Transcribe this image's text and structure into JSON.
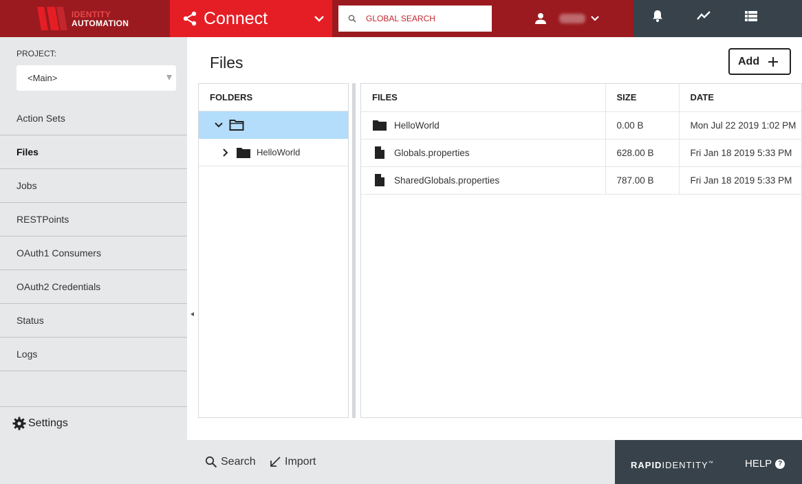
{
  "logo": {
    "line1": "IDENTITY",
    "line2": "AUTOMATION"
  },
  "app_switcher": {
    "name": "Connect"
  },
  "search": {
    "placeholder": "GLOBAL SEARCH"
  },
  "sidebar": {
    "project_label": "PROJECT:",
    "project_value": "<Main>",
    "items": [
      {
        "label": "Action Sets",
        "active": false
      },
      {
        "label": "Files",
        "active": true
      },
      {
        "label": "Jobs",
        "active": false
      },
      {
        "label": "RESTPoints",
        "active": false
      },
      {
        "label": "OAuth1 Consumers",
        "active": false
      },
      {
        "label": "OAuth2 Credentials",
        "active": false
      },
      {
        "label": "Status",
        "active": false
      },
      {
        "label": "Logs",
        "active": false
      }
    ],
    "settings_label": "Settings"
  },
  "main": {
    "title": "Files",
    "add_label": "Add",
    "folders": {
      "header": "FOLDERS",
      "tree": [
        {
          "label": "",
          "expanded": true,
          "selected": true
        },
        {
          "label": "HelloWorld",
          "expanded": false,
          "selected": false
        }
      ]
    },
    "files": {
      "headers": [
        "FILES",
        "SIZE",
        "DATE"
      ],
      "rows": [
        {
          "type": "folder",
          "name": "HelloWorld",
          "size": "0.00 B",
          "date": "Mon Jul 22 2019 1:02 PM"
        },
        {
          "type": "file",
          "name": "Globals.properties",
          "size": "628.00 B",
          "date": "Fri Jan 18 2019 5:33 PM"
        },
        {
          "type": "file",
          "name": "SharedGlobals.properties",
          "size": "787.00 B",
          "date": "Fri Jan 18 2019 5:33 PM"
        }
      ]
    }
  },
  "footer": {
    "search_label": "Search",
    "import_label": "Import",
    "brand_bold": "RAPID",
    "brand_light": "IDENTITY",
    "brand_tm": "™",
    "help_label": "HELP",
    "help_icon_text": "?"
  },
  "colors": {
    "brand_red": "#e51e25",
    "dark_red": "#9b1a1f",
    "slate": "#37424a",
    "sidebar_bg": "#e6e8ea",
    "selection": "#b3ddfb"
  },
  "icons": [
    "share-icon",
    "chevron-down-icon",
    "search-icon",
    "person-icon",
    "bell-icon",
    "activity-icon",
    "list-icon",
    "gear-icon",
    "folder-icon",
    "file-icon",
    "chevron-right-icon",
    "arrow-down-left-icon"
  ]
}
